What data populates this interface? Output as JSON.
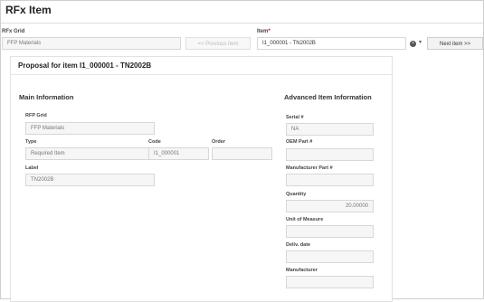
{
  "window": {
    "title": "RFx Item"
  },
  "top": {
    "rfx_grid_label": "RFx Grid",
    "rfx_grid_value": "FFP Materials",
    "previous_label": "<< Previous item",
    "item_label": "Item",
    "item_required_mark": "*",
    "item_value": "I1_000001 - TN2002B",
    "next_label": "Next item >>"
  },
  "panel": {
    "title": "Proposal for item I1_000001 - TN2002B"
  },
  "main_info": {
    "title": "Main Information",
    "rfp_grid_label": "RFP Grid",
    "rfp_grid_value": "FFP Materials",
    "type_label": "Type",
    "type_value": "Required Item",
    "code_label": "Code",
    "code_value": "I1_000001",
    "order_label": "Order",
    "order_value": "",
    "label_label": "Label",
    "label_value": "TN2002B"
  },
  "advanced_info": {
    "title": "Advanced Item Information",
    "serial_label": "Serial #",
    "serial_value": "NA",
    "oem_label": "OEM Part #",
    "oem_value": "",
    "mfr_part_label": "Manufacturer Part #",
    "mfr_part_value": "",
    "quantity_label": "Quantity",
    "quantity_value": "20.00000",
    "uom_label": "Unit of Measure",
    "uom_value": "",
    "deliv_label": "Deliv. date",
    "deliv_value": "",
    "manufacturer_label": "Manufacturer",
    "manufacturer_value": ""
  },
  "icons": {
    "clear": "clear-circle-icon",
    "dropdown": "caret-down-icon"
  },
  "colors": {
    "required": "#dd0000",
    "disabled_text": "#bdbdbd",
    "field_bg": "#f6f6f6"
  }
}
